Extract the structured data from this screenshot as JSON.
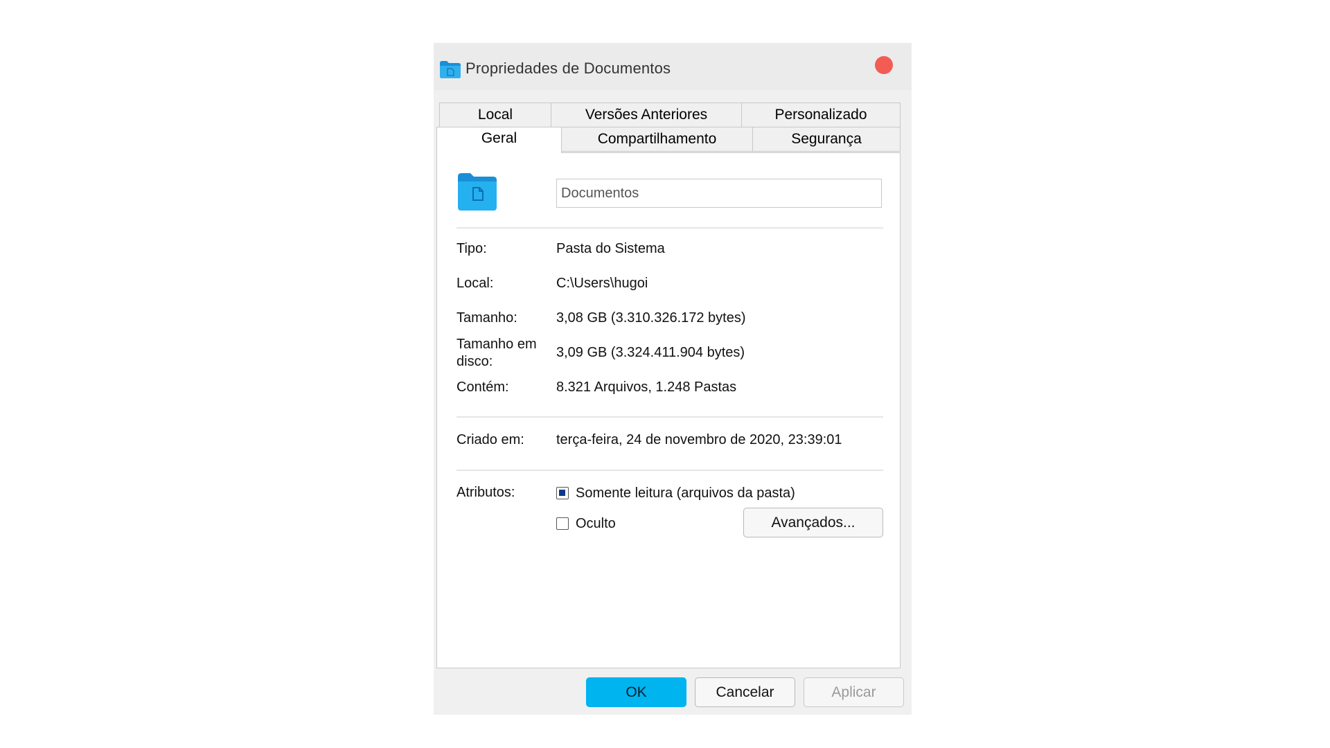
{
  "window": {
    "title": "Propriedades de Documentos",
    "close_icon": "close-icon",
    "accent_color": "#00b4f0"
  },
  "tabs": {
    "row1": [
      "Local",
      "Versões Anteriores",
      "Personalizado"
    ],
    "row2": [
      "Geral",
      "Compartilhamento",
      "Segurança"
    ],
    "active": "Geral"
  },
  "general": {
    "folder_name": "Documentos",
    "type_label": "Tipo:",
    "type_value": "Pasta do Sistema",
    "location_label": "Local:",
    "location_value": "C:\\Users\\hugoi",
    "size_label": "Tamanho:",
    "size_value": "3,08 GB (3.310.326.172 bytes)",
    "disk_size_label_line1": "Tamanho em",
    "disk_size_label_line2": "disco:",
    "disk_size_value": "3,09 GB (3.324.411.904 bytes)",
    "contains_label": "Contém:",
    "contains_value": "8.321 Arquivos, 1.248 Pastas",
    "created_label": "Criado em:",
    "created_value": "terça-feira, 24 de novembro de 2020, 23:39:01",
    "attributes_label": "Atributos:",
    "readonly_label": "Somente leitura (arquivos da pasta)",
    "readonly_checked": true,
    "hidden_label": "Oculto",
    "hidden_checked": false,
    "advanced_button": "Avançados..."
  },
  "buttons": {
    "ok": "OK",
    "cancel": "Cancelar",
    "apply": "Aplicar"
  }
}
